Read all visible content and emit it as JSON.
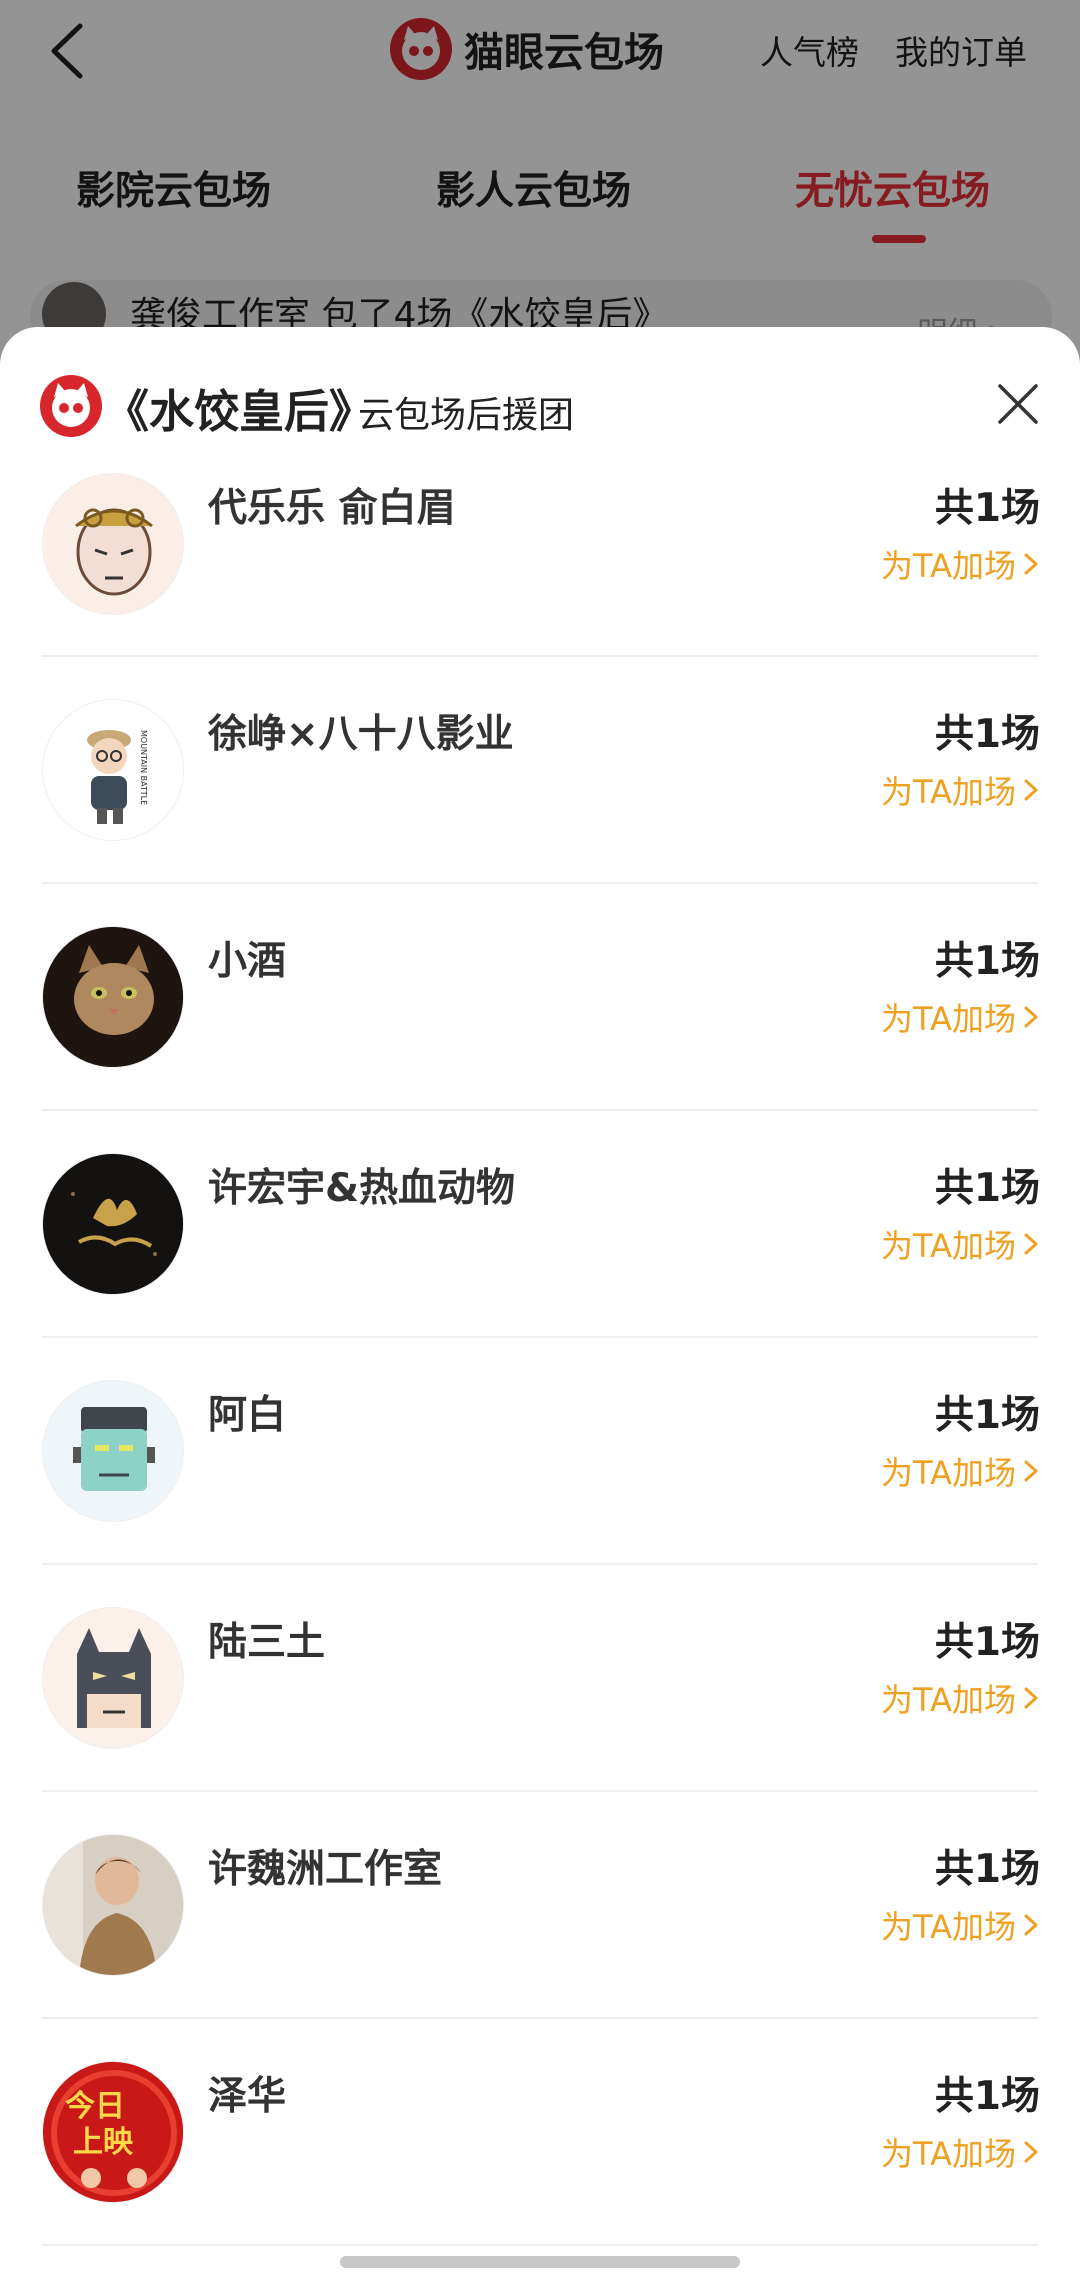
{
  "topbar": {
    "brand_name": "猫眼云包场",
    "rank_link": "人气榜",
    "orders_link": "我的订单"
  },
  "tabs": [
    {
      "label": "影院云包场",
      "active": false
    },
    {
      "label": "影人云包场",
      "active": false
    },
    {
      "label": "无忧云包场",
      "active": true
    }
  ],
  "notice": {
    "text": "龚俊工作室 包了4场《水饺皇后》",
    "detail": "明细 >"
  },
  "sheet": {
    "title": "《水饺皇后》",
    "subtitle": "云包场后援团"
  },
  "supporters": [
    {
      "name": "代乐乐 俞白眉",
      "count": "共1场",
      "action": "为TA加场",
      "avatar": "monkey-king-avatar"
    },
    {
      "name": "徐峥×八十八影业",
      "count": "共1场",
      "action": "为TA加场",
      "avatar": "cartoon-man-avatar"
    },
    {
      "name": "小酒",
      "count": "共1场",
      "action": "为TA加场",
      "avatar": "cat-photo-avatar"
    },
    {
      "name": "许宏宇&热血动物",
      "count": "共1场",
      "action": "为TA加场",
      "avatar": "gold-logo-avatar"
    },
    {
      "name": "阿白",
      "count": "共1场",
      "action": "为TA加场",
      "avatar": "frankenstein-avatar"
    },
    {
      "name": "陆三土",
      "count": "共1场",
      "action": "为TA加场",
      "avatar": "batman-avatar"
    },
    {
      "name": "许魏洲工作室",
      "count": "共1场",
      "action": "为TA加场",
      "avatar": "portrait-photo-avatar"
    },
    {
      "name": "泽华",
      "count": "共1场",
      "action": "为TA加场",
      "avatar": "red-poster-avatar"
    }
  ],
  "colors": {
    "accent_red": "#e8303a",
    "brand_red": "#d8262d",
    "action_orange": "#f0a020"
  }
}
